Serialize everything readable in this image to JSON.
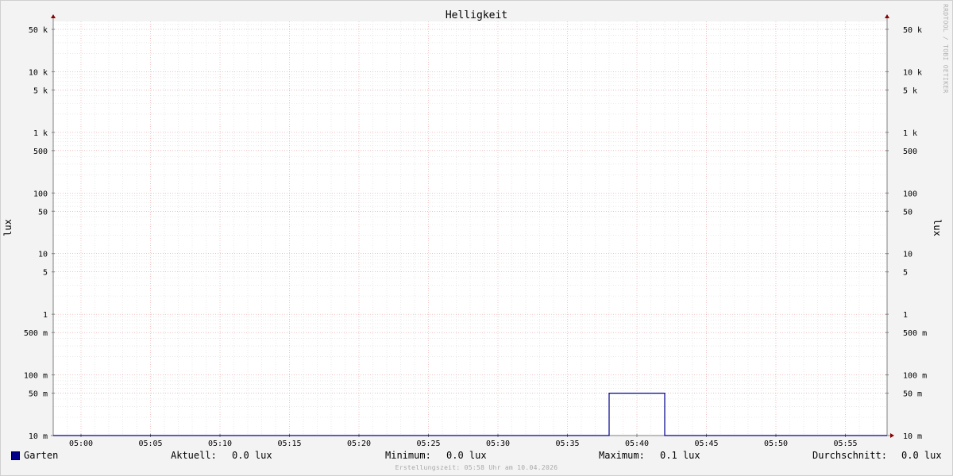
{
  "chart_data": {
    "type": "line",
    "title": "Helligkeit",
    "ylabel": "lux",
    "ylabel_right": "lux",
    "yscale": "log",
    "ylim": [
      0.01,
      70000
    ],
    "xlim": [
      "04:58",
      "05:58"
    ],
    "x_ticks": [
      "05:00",
      "05:05",
      "05:10",
      "05:15",
      "05:20",
      "05:25",
      "05:30",
      "05:35",
      "05:40",
      "05:45",
      "05:50",
      "05:55"
    ],
    "y_ticks": [
      {
        "value": 50000,
        "label": "50 k"
      },
      {
        "value": 10000,
        "label": "10 k"
      },
      {
        "value": 5000,
        "label": "5 k"
      },
      {
        "value": 1000,
        "label": "1 k"
      },
      {
        "value": 500,
        "label": "500"
      },
      {
        "value": 100,
        "label": "100"
      },
      {
        "value": 50,
        "label": "50"
      },
      {
        "value": 10,
        "label": "10"
      },
      {
        "value": 5,
        "label": "5"
      },
      {
        "value": 1,
        "label": "1"
      },
      {
        "value": 0.5,
        "label": "500 m"
      },
      {
        "value": 0.1,
        "label": "100 m"
      },
      {
        "value": 0.05,
        "label": "50 m"
      },
      {
        "value": 0.01,
        "label": "10 m"
      }
    ],
    "series": [
      {
        "name": "Garten",
        "color": "#00008b",
        "points": [
          [
            "04:58",
            0.01
          ],
          [
            "05:38",
            0.01
          ],
          [
            "05:38",
            0.05
          ],
          [
            "05:42",
            0.05
          ],
          [
            "05:42",
            0.01
          ],
          [
            "05:58",
            0.01
          ]
        ]
      }
    ],
    "grid": true,
    "legend_position": "bottom"
  },
  "legend": {
    "series_name": "Garten",
    "aktuell_label": "Aktuell:",
    "aktuell_value": "0.0 lux",
    "minimum_label": "Minimum:",
    "minimum_value": "0.0 lux",
    "maximum_label": "Maximum:",
    "maximum_value": "0.1 lux",
    "durchschnitt_label": "Durchschnitt:",
    "durchschnitt_value": "0.0 lux"
  },
  "footer": "Erstellungszeit: 05:58 Uhr am 10.04.2026",
  "watermark": "RRDTOOL / TOBI OETIKER"
}
